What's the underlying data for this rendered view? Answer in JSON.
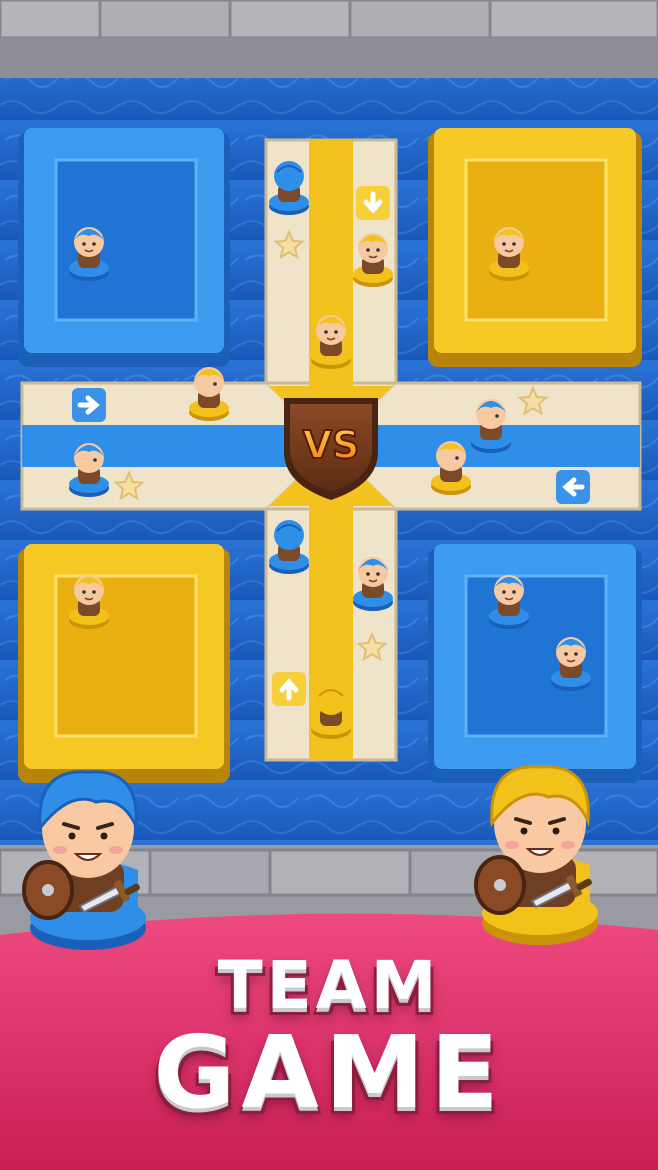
{
  "game": {
    "center_badge": "VS",
    "title_lines": [
      "TEAM",
      "GAME"
    ]
  },
  "colors": {
    "water": "#1f66c9",
    "water_light": "#3a8be6",
    "blue_team": "#2f8fe8",
    "blue_team_dark": "#1a5fb8",
    "yellow_team": "#f2c21b",
    "yellow_team_dark": "#c9930a",
    "path_stone": "#efe4c9",
    "banner_pink": "#e3316a",
    "wall_stone": "#a9a9b0"
  },
  "board": {
    "path_arrows": [
      {
        "id": "arrow-top",
        "direction": "down"
      },
      {
        "id": "arrow-left",
        "direction": "right"
      },
      {
        "id": "arrow-right",
        "direction": "left"
      },
      {
        "id": "arrow-bottom",
        "direction": "up"
      }
    ],
    "safe_stars": 4
  },
  "pieces": [
    {
      "team": "blue",
      "facing": "back"
    },
    {
      "team": "yellow",
      "facing": "front"
    },
    {
      "team": "yellow",
      "facing": "front"
    },
    {
      "team": "yellow",
      "facing": "side"
    },
    {
      "team": "blue",
      "facing": "side"
    },
    {
      "team": "blue",
      "facing": "side"
    },
    {
      "team": "yellow",
      "facing": "side"
    },
    {
      "team": "blue",
      "facing": "back"
    },
    {
      "team": "blue",
      "facing": "front"
    },
    {
      "team": "yellow",
      "facing": "back"
    },
    {
      "team": "blue",
      "facing": "front"
    },
    {
      "team": "yellow",
      "facing": "front"
    },
    {
      "team": "yellow",
      "facing": "front"
    },
    {
      "team": "blue",
      "facing": "front"
    },
    {
      "team": "blue",
      "facing": "front"
    }
  ],
  "mascots": [
    {
      "team": "blue",
      "weapon": "sword-and-shield"
    },
    {
      "team": "yellow",
      "weapon": "sword-and-shield"
    }
  ]
}
